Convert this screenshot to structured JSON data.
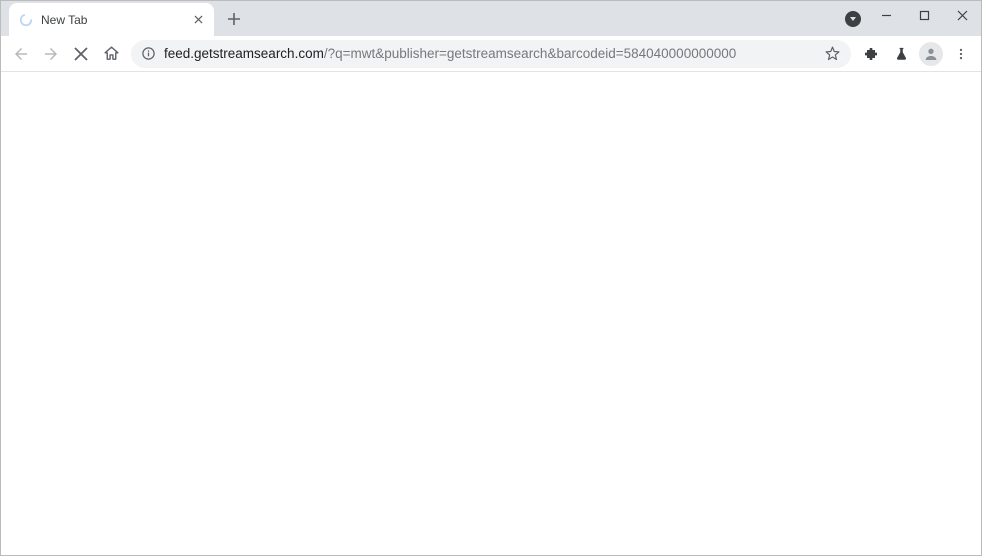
{
  "tab": {
    "title": "New Tab"
  },
  "url": {
    "domain": "feed.getstreamsearch.com",
    "path": "/?q=mwt&publisher=getstreamsearch&barcodeid=584040000000000"
  }
}
